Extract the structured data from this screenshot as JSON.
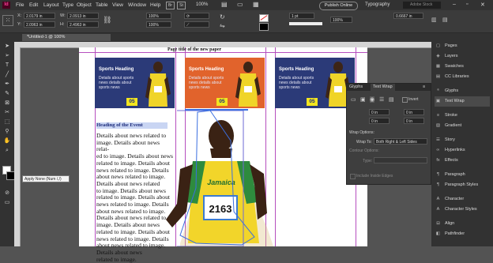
{
  "menu": {
    "logo": "Id",
    "items": [
      "File",
      "Edit",
      "Layout",
      "Type",
      "Object",
      "Table",
      "View",
      "Window",
      "Help"
    ],
    "zoom": "100%"
  },
  "publish_label": "Publish Online",
  "workspace_label": "Typography",
  "search_placeholder": "Adobe Stock",
  "control": {
    "x_label": "X:",
    "x_value": "2.0179 in",
    "y_label": "Y:",
    "y_value": "2.0963 in",
    "w_label": "W:",
    "w_value": "2.0913 in",
    "h_label": "H:",
    "h_value": "2.4963 in",
    "zoom_w": "100%",
    "zoom_h": "100%",
    "stroke": "1 pt",
    "stroke_pct": "100%",
    "ref_value": "0.6667 in"
  },
  "document_tab": "*Untitled-1 @ 100%",
  "page": {
    "title": "Page title of the new paper",
    "cards": [
      {
        "heading": "Sports Heading",
        "body": "Details about sports news details about sports news",
        "number": "05",
        "bg": "#2b3a78"
      },
      {
        "heading": "Sports Heading",
        "body": "Details about sports news details about sports news",
        "number": "05",
        "bg": "#e1632c"
      },
      {
        "heading": "Sports Heading",
        "body": "Details about sports news details about sports news",
        "number": "05",
        "bg": "#2b3a78"
      }
    ],
    "event_heading": "Heading of the Event",
    "body_lines": [
      "Details about news related to",
      "image. Details about news relat-",
      "ed to image. Details about news",
      "related to image. Details about",
      "news related to image. Details",
      "about news related to image.",
      "Details about news related",
      "to image. Details about news",
      "related to image. Details about",
      "news related to image. Details",
      "about news related to image.",
      "Details about news related to",
      "image. Details about news",
      "related to image. Details about",
      "news related to image. Details",
      "about news related to image.",
      "Details about news",
      "related to image."
    ],
    "bib": "2163",
    "jersey": "Jamaica"
  },
  "textwrap": {
    "tab1": "Glyphs",
    "tab2": "Text Wrap",
    "invert": "Invert",
    "off1": "0 in",
    "off2": "0 in",
    "off3": "0 in",
    "off4": "0 in",
    "wrap_options": "Wrap Options:",
    "wrap_to_label": "Wrap To:",
    "wrap_to_value": "Both Right & Left Sides",
    "contour_options": "Contour Options:",
    "type_label": "Type:",
    "include_edges": "Include Inside Edges"
  },
  "dock_items": [
    "Pages",
    "Layers",
    "Swatches",
    "CC Libraries",
    "Glyphs",
    "Text Wrap",
    "Stroke",
    "Gradient",
    "Story",
    "Hyperlinks",
    "Effects",
    "Paragraph",
    "Paragraph Styles",
    "Character",
    "Character Styles",
    "Align",
    "Pathfinder"
  ],
  "tooltip": "Apply None (Num /,/)",
  "colors": {
    "accent": "#ff3d9a",
    "guide": "#b64fbf",
    "card_blue": "#2b3a78",
    "card_orange": "#e1632c",
    "yellow": "#f2e51f"
  }
}
